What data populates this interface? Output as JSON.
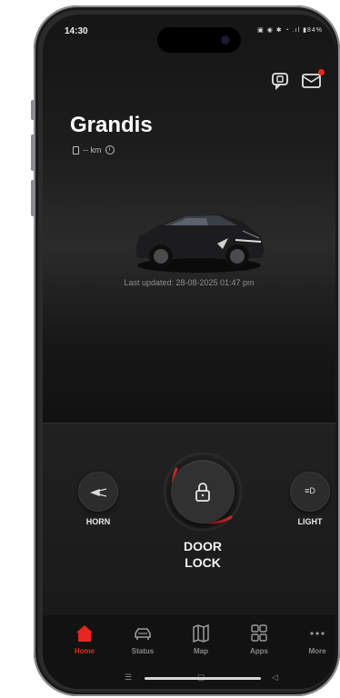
{
  "status_bar": {
    "time": "14:30",
    "indicators": "▣ ◉ ✱ ◔ .ıl ▮84%"
  },
  "header": {
    "chat_icon": "chat-icon",
    "inbox_icon": "mail-icon",
    "notification_color": "#e5271f"
  },
  "vehicle": {
    "name": "Grandis",
    "range": "-- km",
    "fuel_icon": "fuel-icon",
    "info_icon": "info-icon",
    "info_glyph": "i",
    "last_updated": "Last updated: 28-08-2025 01:47 pm"
  },
  "controls": {
    "horn": {
      "label": "HORN",
      "icon": "horn-icon"
    },
    "door_lock": {
      "label_line1": "DOOR",
      "label_line2": "LOCK",
      "icon": "lock-icon"
    },
    "light": {
      "label": "LIGHT",
      "icon": "headlight-icon",
      "glyph": "≡D"
    }
  },
  "nav": {
    "items": [
      {
        "label": "Home",
        "icon": "home-icon",
        "active": true
      },
      {
        "label": "Status",
        "icon": "car-icon",
        "active": false
      },
      {
        "label": "Map",
        "icon": "map-icon",
        "active": false
      },
      {
        "label": "Apps",
        "icon": "grid-icon",
        "active": false
      },
      {
        "label": "More",
        "icon": "more-icon",
        "active": false
      }
    ]
  },
  "system_nav": {
    "menu_glyph": "☰",
    "home_glyph": "▢",
    "back_glyph": "◁"
  },
  "colors": {
    "accent": "#e5271f",
    "background": "#151515",
    "text": "#ffffff"
  }
}
